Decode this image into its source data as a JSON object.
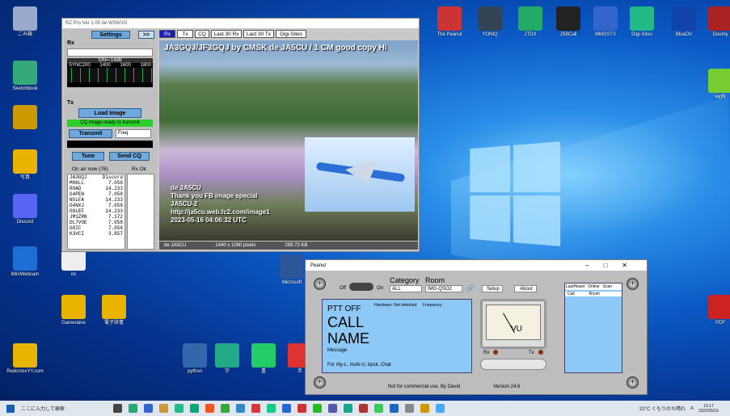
{
  "desktop": {
    "icons": [
      {
        "label": "ごみ箱",
        "color": "#9ac"
      },
      {
        "label": "Sketchbook",
        "color": "#3a7"
      },
      {
        "label": "",
        "color": "#c90"
      },
      {
        "label": "写真",
        "color": "#e8b400"
      },
      {
        "label": "Discord",
        "color": "#5865f2"
      },
      {
        "label": "MiniWebcam",
        "color": "#1d6fd6"
      },
      {
        "label": "ilo",
        "color": "#eee"
      },
      {
        "label": "Gameraine",
        "color": "#e8b400"
      },
      {
        "label": "RedcrossYY.com",
        "color": "#e8b400"
      },
      {
        "label": "The Peanut",
        "color": "#c33"
      },
      {
        "label": "YONIQ",
        "color": "#345"
      },
      {
        "label": "JTDX",
        "color": "#2a6"
      },
      {
        "label": "JS8Call",
        "color": "#222"
      },
      {
        "label": "MMSSTV",
        "color": "#36c"
      },
      {
        "label": "Digi-Sites",
        "color": "#2b8"
      },
      {
        "label": "BlueDV",
        "color": "#14a"
      },
      {
        "label": "Doomy",
        "color": "#a22"
      },
      {
        "label": "wyjfk",
        "color": "#7c3"
      },
      {
        "label": "Microsoft",
        "color": "#2b579a"
      },
      {
        "label": "電子辞書",
        "color": "#e8b400"
      },
      {
        "label": "PDF",
        "color": "#c22"
      },
      {
        "label": "python",
        "color": "#36a"
      },
      {
        "label": "字",
        "color": "#2a8"
      },
      {
        "label": "重",
        "color": "#2c6"
      },
      {
        "label": "手",
        "color": "#d33"
      }
    ]
  },
  "rz": {
    "title": "RZ Pro  Ver 1.00 de W5WVO",
    "settings": "Settings",
    "arrows": ">>",
    "rx_label": "Rx",
    "snr": "S/N=-14dB",
    "sync": "SYNC200",
    "scale": [
      "1400",
      "1600",
      "1800"
    ],
    "tx_label": "Tx",
    "load": "Load Image",
    "cq_status": "CQ Image ready to transmit",
    "transmit": "Transmit",
    "mode": "Freq",
    "tune": "Tune",
    "send_cq": "Send CQ",
    "onair_header": "On air now (76)",
    "rxok": "Rx Ok",
    "onair": [
      [
        "JA3GQJ",
        "Discord"
      ],
      [
        "M0KLL",
        "7.058"
      ],
      [
        "R0AD",
        "14.233"
      ],
      [
        "G4PEN",
        "7.058"
      ],
      [
        "N5LFA",
        "14.233"
      ],
      [
        "G4NXJ",
        "7.058"
      ],
      [
        "G0LEF",
        "14.233"
      ],
      [
        "JM1ZRN",
        "7.172"
      ],
      [
        "DL7VOE",
        "7.058"
      ],
      [
        "G8IC",
        "7.058"
      ],
      [
        "K3VCI",
        "3.857"
      ]
    ],
    "tabs": [
      "Rx",
      "Tx",
      "CQ",
      "Last 30 Rx",
      "Last 30 Tx",
      "Digi-Sites"
    ],
    "photo_top": "JA3GQJ/JF3GQJ  by  CMSK  de  JA5CU / 1 CM  good copy Hi",
    "photo_lines": [
      "de JA5CU",
      "Thank you FB image special",
      "JA5CU-2",
      "http://ja5cu.web.fc2.com/image1",
      "2023-05-16 04:06:32 UTC"
    ],
    "status": [
      "de JA5CU",
      "1440 x 1080 pixels",
      "299.73 KB"
    ]
  },
  "peanut": {
    "title": "Peanut",
    "off": "Off",
    "on": "On",
    "category": "Category",
    "room": "Room",
    "cat_val": "ALL",
    "room_val": "IMG-QSO2",
    "setup": "Setup",
    "about": "About",
    "ptt": "PTT OFF",
    "hw": "Hardware",
    "hw_val": "Not detected",
    "freq": "Frequency",
    "call": "CALL",
    "name": "NAME",
    "message": "Message",
    "modes": "For rtty-L, msfk-U, bpsk, Chat",
    "vu": "VU",
    "rx": "Rx",
    "tx": "Tx",
    "list_tabs": [
      "LastHeard",
      "Online",
      "Scan"
    ],
    "cols": [
      "Call",
      "Room"
    ],
    "footer": "Not for commercial use. By David",
    "version": "Version 24.6"
  },
  "taskbar": {
    "search": "ここに入力して検索",
    "weather": "22°C くもりのち晴れ",
    "time": "19:17",
    "date": "2023/05/16",
    "ime": "A"
  }
}
